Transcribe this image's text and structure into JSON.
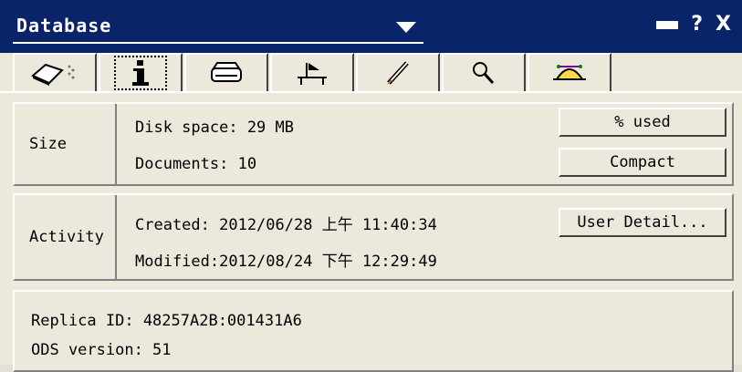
{
  "window": {
    "title": "Database",
    "help_label": "?",
    "close_label": "X"
  },
  "tabs": [
    {
      "icon": "eraser-icon"
    },
    {
      "icon": "info-icon"
    },
    {
      "icon": "printer-icon"
    },
    {
      "icon": "chair-icon"
    },
    {
      "icon": "pen-icon"
    },
    {
      "icon": "magnifier-icon"
    },
    {
      "icon": "hat-icon"
    }
  ],
  "size": {
    "label": "Size",
    "disk_space": "Disk space:  29 MB",
    "documents": "Documents:   10",
    "percent_used_button": "% used",
    "compact_button": "Compact"
  },
  "activity": {
    "label": "Activity",
    "created": "Created:  2012/06/28 上午 11:40:34",
    "modified": "Modified:2012/08/24 下午 12:29:49",
    "user_detail_button": "User Detail..."
  },
  "replica": {
    "replica_id": "Replica ID:   48257A2B:001431A6",
    "ods_version": "ODS version:  51"
  }
}
